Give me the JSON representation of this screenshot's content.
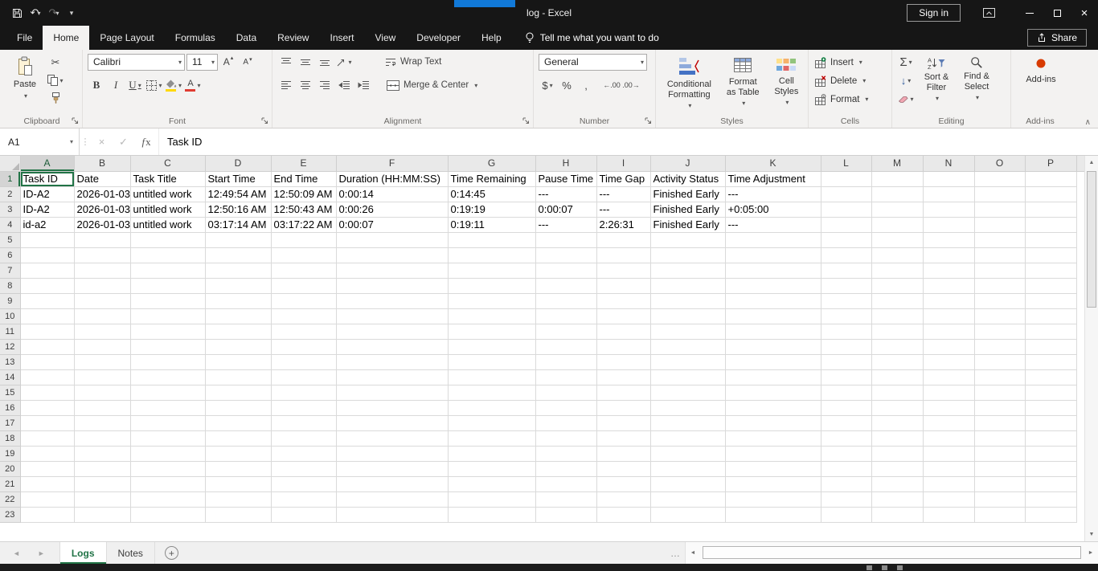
{
  "titlebar": {
    "title": "log  -  Excel",
    "sign_in_label": "Sign in"
  },
  "ribbon": {
    "tabs": [
      "File",
      "Home",
      "Page Layout",
      "Formulas",
      "Data",
      "Review",
      "Insert",
      "View",
      "Developer",
      "Help"
    ],
    "active_tab": "Home",
    "tell_me": "Tell me what you want to do",
    "share_label": "Share",
    "groups": {
      "clipboard": {
        "label": "Clipboard",
        "paste": "Paste"
      },
      "font": {
        "label": "Font",
        "font_name": "Calibri",
        "font_size": "11"
      },
      "alignment": {
        "label": "Alignment",
        "wrap_text": "Wrap Text",
        "merge_center": "Merge & Center"
      },
      "number": {
        "label": "Number",
        "format": "General"
      },
      "styles": {
        "label": "Styles",
        "conditional_formatting": "Conditional Formatting",
        "format_as_table": "Format as Table",
        "cell_styles": "Cell Styles"
      },
      "cells": {
        "label": "Cells",
        "insert": "Insert",
        "delete": "Delete",
        "format": "Format"
      },
      "editing": {
        "label": "Editing",
        "sort_filter": "Sort & Filter",
        "find_select": "Find & Select"
      },
      "addins": {
        "label": "Add-ins",
        "button": "Add-ins"
      }
    }
  },
  "formula_bar": {
    "name_box": "A1",
    "content": "Task ID"
  },
  "sheet": {
    "columns": [
      "A",
      "B",
      "C",
      "D",
      "E",
      "F",
      "G",
      "H",
      "I",
      "J",
      "K",
      "L",
      "M",
      "N",
      "O",
      "P"
    ],
    "visible_rows": 23,
    "active_cell": "A1",
    "cells": [
      [
        "Task ID",
        "Date",
        "Task Title",
        "Start Time",
        "End Time",
        "Duration (HH:MM:SS)",
        "Time Remaining",
        "Pause Time",
        "Time Gap",
        "Activity Status",
        "Time Adjustment"
      ],
      [
        "ID-A2",
        "2026-01-03",
        "untitled work",
        "12:49:54 AM",
        "12:50:09 AM",
        "0:00:14",
        "0:14:45",
        "---",
        "---",
        "Finished Early",
        "---"
      ],
      [
        "ID-A2",
        "2026-01-03",
        "untitled work",
        "12:50:16 AM",
        "12:50:43 AM",
        "0:00:26",
        "0:19:19",
        "0:00:07",
        "---",
        "Finished Early",
        "+0:05:00"
      ],
      [
        "id-a2",
        "2026-01-03",
        "untitled work",
        "03:17:14 AM",
        "03:17:22 AM",
        "0:00:07",
        "0:19:11",
        "---",
        "2:26:31",
        "Finished Early",
        "---"
      ]
    ]
  },
  "sheet_tabs": [
    {
      "name": "Logs",
      "active": true
    },
    {
      "name": "Notes",
      "active": false
    }
  ],
  "colors": {
    "accent": "#217346",
    "selection_border": "#217346",
    "addins_dot": "#d83b01"
  }
}
